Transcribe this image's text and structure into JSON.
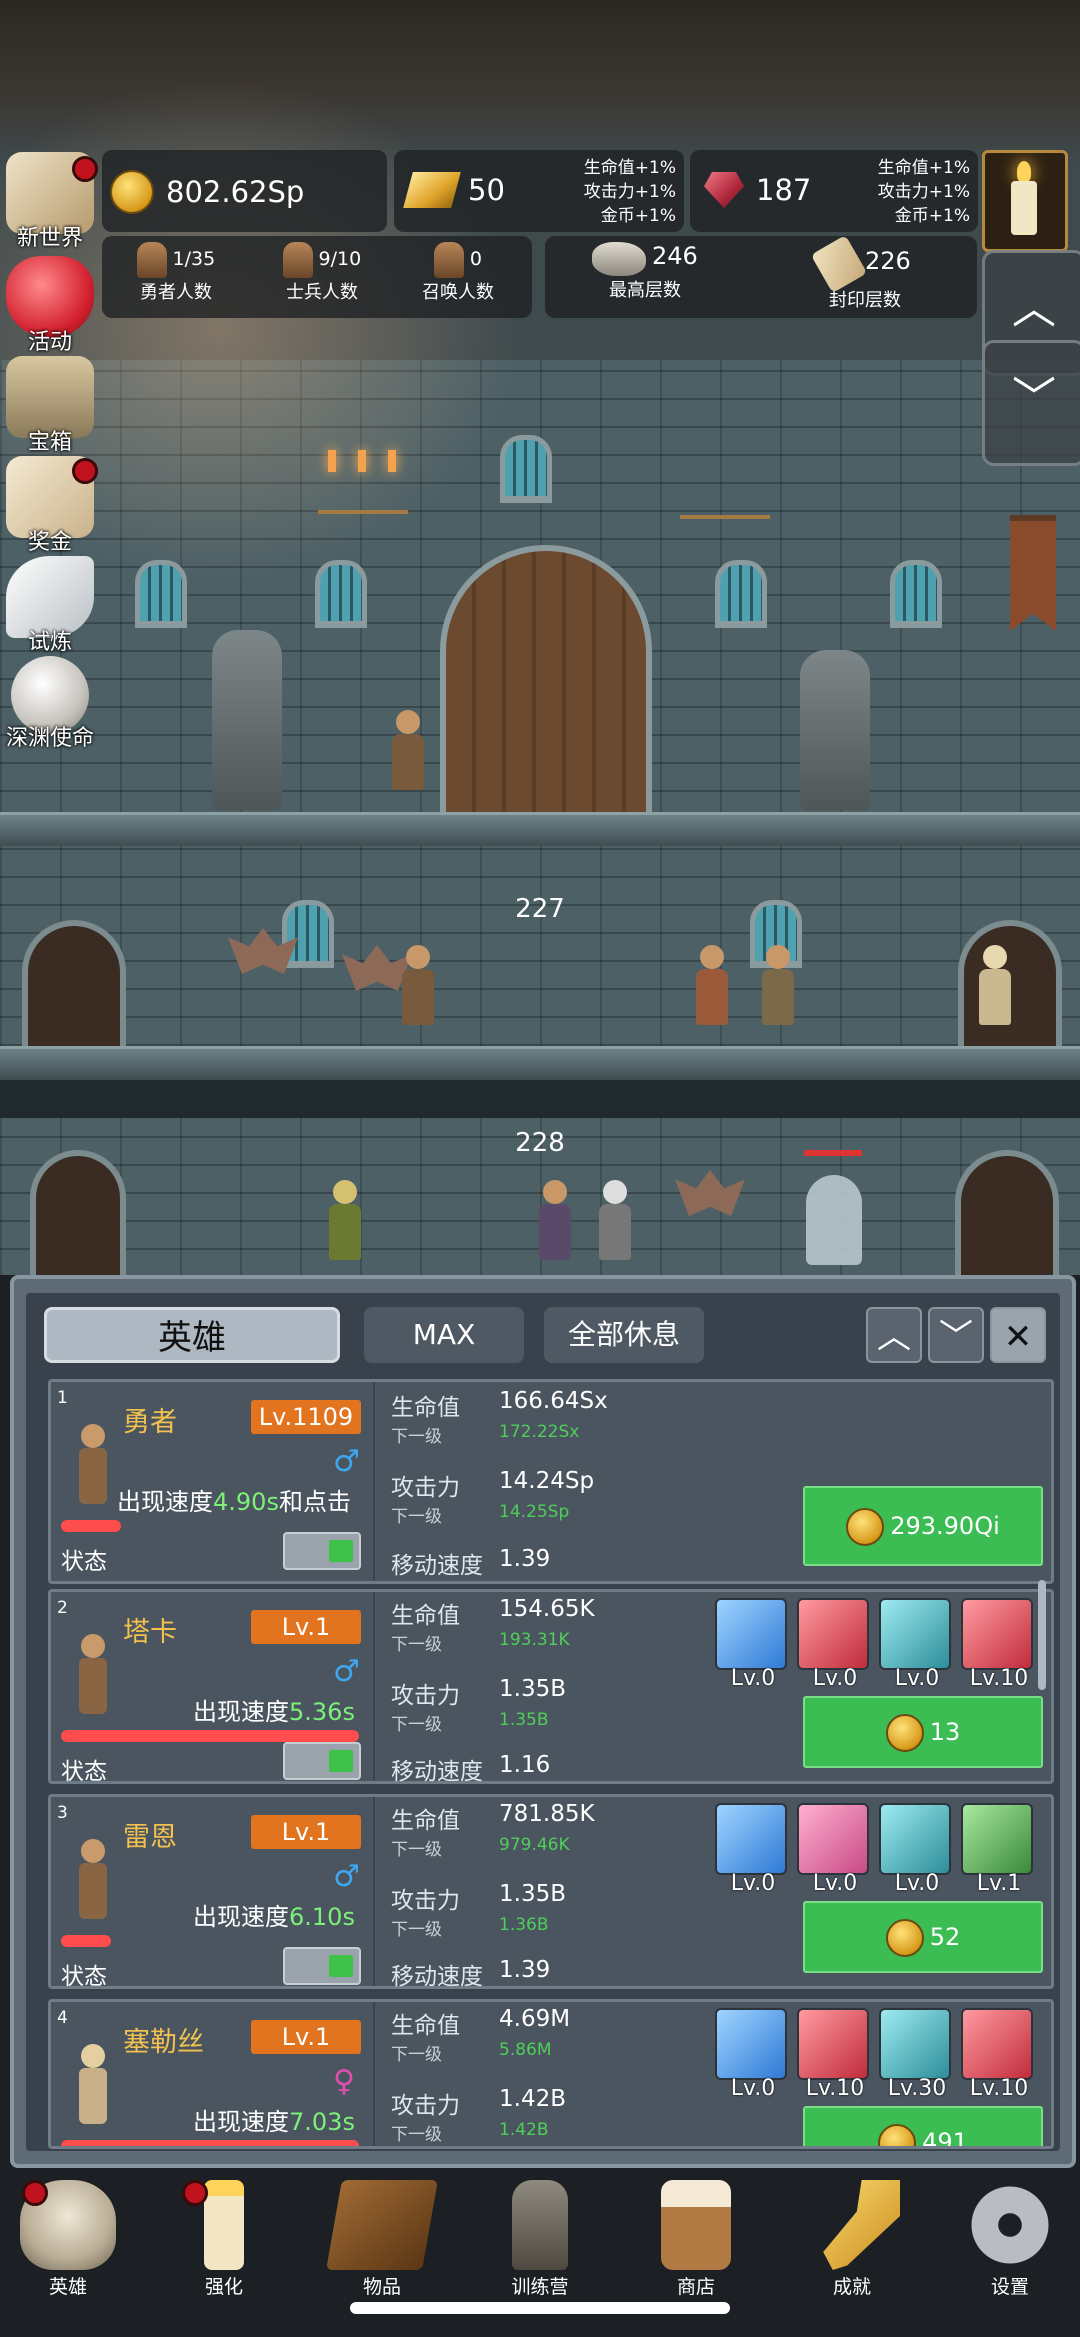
{
  "hud": {
    "currency_gold": "802.62Sp",
    "currency_bar": "50",
    "currency_bar_bonus": [
      "生命值+1%",
      "攻击力+1%",
      "金币+1%"
    ],
    "currency_gem": "187",
    "currency_gem_bonus": [
      "生命值+1%",
      "攻击力+1%",
      "金币+1%"
    ],
    "hero_count": "1/35",
    "hero_count_label": "勇者人数",
    "soldier_count": "9/10",
    "soldier_count_label": "士兵人数",
    "summon_count": "0",
    "summon_count_label": "召唤人数",
    "max_floor": "246",
    "max_floor_label": "最高层数",
    "sealed_floor": "226",
    "sealed_floor_label": "封印层数",
    "up_arrow": "︿",
    "down_arrow": "﹀"
  },
  "side_menu": [
    {
      "label": "新世界",
      "icon": "map-icon",
      "badge": true
    },
    {
      "label": "活动",
      "icon": "heart-icon",
      "badge": false
    },
    {
      "label": "宝箱",
      "icon": "chest-icon",
      "badge": false
    },
    {
      "label": "奖金",
      "icon": "letter-icon",
      "badge": true
    },
    {
      "label": "试炼",
      "icon": "feather-icon",
      "badge": false
    },
    {
      "label": "深渊使命",
      "icon": "pearl-icon",
      "badge": false
    }
  ],
  "scene": {
    "floor_a": "227",
    "floor_b": "228"
  },
  "panel": {
    "tab_hero": "英雄",
    "tab_max": "MAX",
    "tab_rest": "全部休息",
    "up": "︿",
    "down": "﹀",
    "close": "✕"
  },
  "heroes": [
    {
      "index": "1",
      "name": "勇者",
      "level": "Lv.1109",
      "gender": "♂",
      "gender_color": "#3fa7f0",
      "speed_prefix": "出现速度",
      "speed": "4.90s",
      "speed_suffix": "和点击",
      "status_label": "状态",
      "hp_label": "生命值",
      "hp": "166.64Sx",
      "hp_next_label": "下一级",
      "hp_next": "172.22Sx",
      "atk_label": "攻击力",
      "atk": "14.24Sp",
      "atk_next_label": "下一级",
      "atk_next": "14.25Sp",
      "move_label": "移动速度",
      "move": "1.39",
      "upgrade_cost": "293.90Qi"
    },
    {
      "index": "2",
      "name": "塔卡",
      "level": "Lv.1",
      "gender": "♂",
      "gender_color": "#3fa7f0",
      "speed_prefix": "出现速度",
      "speed": "5.36s",
      "speed_suffix": "",
      "status_label": "状态",
      "hp_label": "生命值",
      "hp": "154.65K",
      "hp_next_label": "下一级",
      "hp_next": "193.31K",
      "atk_label": "攻击力",
      "atk": "1.35B",
      "atk_next_label": "下一级",
      "atk_next": "1.35B",
      "move_label": "移动速度",
      "move": "1.16",
      "equip": [
        {
          "level": "Lv.0",
          "icon": "shield-icon",
          "style": "blue"
        },
        {
          "level": "Lv.0",
          "icon": "axe-icon",
          "style": "redb"
        },
        {
          "level": "Lv.0",
          "icon": "boots-icon",
          "style": "tealb"
        },
        {
          "level": "Lv.10",
          "icon": "crossbow-icon",
          "style": "redb"
        }
      ],
      "upgrade_cost": "13"
    },
    {
      "index": "3",
      "name": "雷恩",
      "level": "Lv.1",
      "gender": "♂",
      "gender_color": "#3fa7f0",
      "speed_prefix": "出现速度",
      "speed": "6.10s",
      "speed_suffix": "",
      "status_label": "状态",
      "hp_label": "生命值",
      "hp": "781.85K",
      "hp_next_label": "下一级",
      "hp_next": "979.46K",
      "atk_label": "攻击力",
      "atk": "1.35B",
      "atk_next_label": "下一级",
      "atk_next": "1.36B",
      "move_label": "移动速度",
      "move": "1.39",
      "equip": [
        {
          "level": "Lv.0",
          "icon": "shield-icon",
          "style": "blue"
        },
        {
          "level": "Lv.0",
          "icon": "sword-icon",
          "style": "pinkb"
        },
        {
          "level": "Lv.0",
          "icon": "boots-icon",
          "style": "tealb"
        },
        {
          "level": "Lv.1",
          "icon": "serpent-icon",
          "style": "greenb"
        }
      ],
      "upgrade_cost": "52"
    },
    {
      "index": "4",
      "name": "塞勒丝",
      "level": "Lv.1",
      "gender": "♀",
      "gender_color": "#e04fb0",
      "speed_prefix": "出现速度",
      "speed": "7.03s",
      "speed_suffix": "",
      "hp_label": "生命值",
      "hp": "4.69M",
      "hp_next_label": "下一级",
      "hp_next": "5.86M",
      "atk_label": "攻击力",
      "atk": "1.42B",
      "atk_next_label": "下一级",
      "atk_next": "1.42B",
      "equip": [
        {
          "level": "Lv.0",
          "icon": "star-shield-icon",
          "style": "blue"
        },
        {
          "level": "Lv.10",
          "icon": "monster-icon",
          "style": "redb"
        },
        {
          "level": "Lv.30",
          "icon": "boots-icon",
          "style": "tealb"
        },
        {
          "level": "Lv.10",
          "icon": "staff-icon",
          "style": "redb"
        }
      ],
      "upgrade_cost": "491"
    }
  ],
  "nav": [
    {
      "label": "英雄",
      "icon": "skull-icon",
      "badge": true
    },
    {
      "label": "强化",
      "icon": "candle-icon",
      "badge": true
    },
    {
      "label": "物品",
      "icon": "book-icon",
      "badge": false
    },
    {
      "label": "训练营",
      "icon": "lantern-icon",
      "badge": false
    },
    {
      "label": "商店",
      "icon": "mug-icon",
      "badge": false
    },
    {
      "label": "成就",
      "icon": "key-icon",
      "badge": false
    },
    {
      "label": "设置",
      "icon": "gear-icon",
      "badge": false
    }
  ]
}
